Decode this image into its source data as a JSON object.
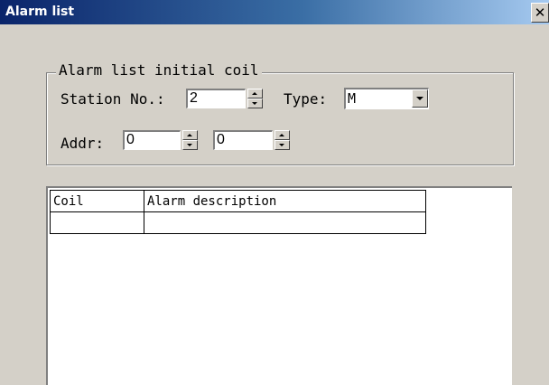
{
  "window": {
    "title": "Alarm list",
    "close_glyph": "✕",
    "close_icon": "close-icon"
  },
  "group": {
    "title": "Alarm list initial coil",
    "station_label": "Station No.:",
    "station_value": "2",
    "type_label": "Type:",
    "type_value": "M",
    "addr_label": "Addr:",
    "addr_value_1": "0",
    "addr_value_2": "0"
  },
  "table": {
    "headers": [
      "Coil",
      "Alarm description"
    ],
    "rows": [
      [
        "",
        ""
      ]
    ]
  },
  "colors": {
    "titlebar_start": "#0a246a",
    "titlebar_end": "#a6caf0",
    "dialog_bg": "#d4d0c8"
  }
}
